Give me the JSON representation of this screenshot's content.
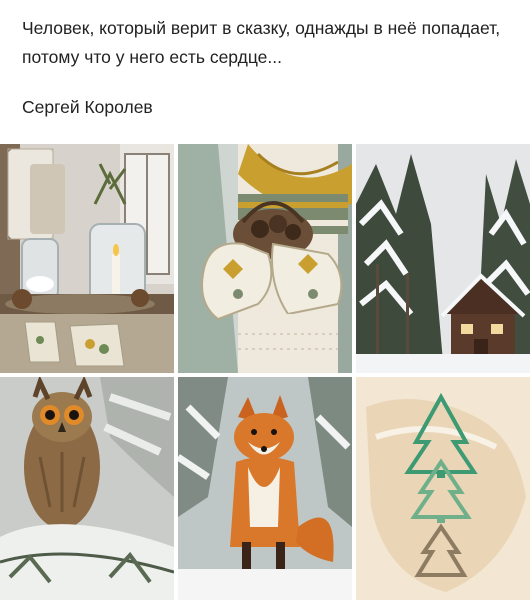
{
  "post": {
    "quote": "Человек, который верит в сказку, однажды в неё попадает, потому что у него есть сердце...",
    "author": "Сергей Королев"
  },
  "gallery": {
    "photos": [
      {
        "subject": "winter-porch-still-life",
        "icon": "jar-pinecone-icon"
      },
      {
        "subject": "knit-mittens-basket",
        "icon": "mitten-icon"
      },
      {
        "subject": "snowy-forest-cabin",
        "icon": "cabin-icon"
      },
      {
        "subject": "owl-on-snowy-branch",
        "icon": "owl-icon"
      },
      {
        "subject": "fox-in-snow",
        "icon": "fox-icon"
      },
      {
        "subject": "tree-cookie-cutters",
        "icon": "tree-cutter-icon"
      }
    ]
  },
  "colors": {
    "background": "#ffffff",
    "text": "#222222",
    "accent_fox": "#d9782b",
    "mustard": "#c9a02f",
    "cabin": "#5a3a2a"
  }
}
